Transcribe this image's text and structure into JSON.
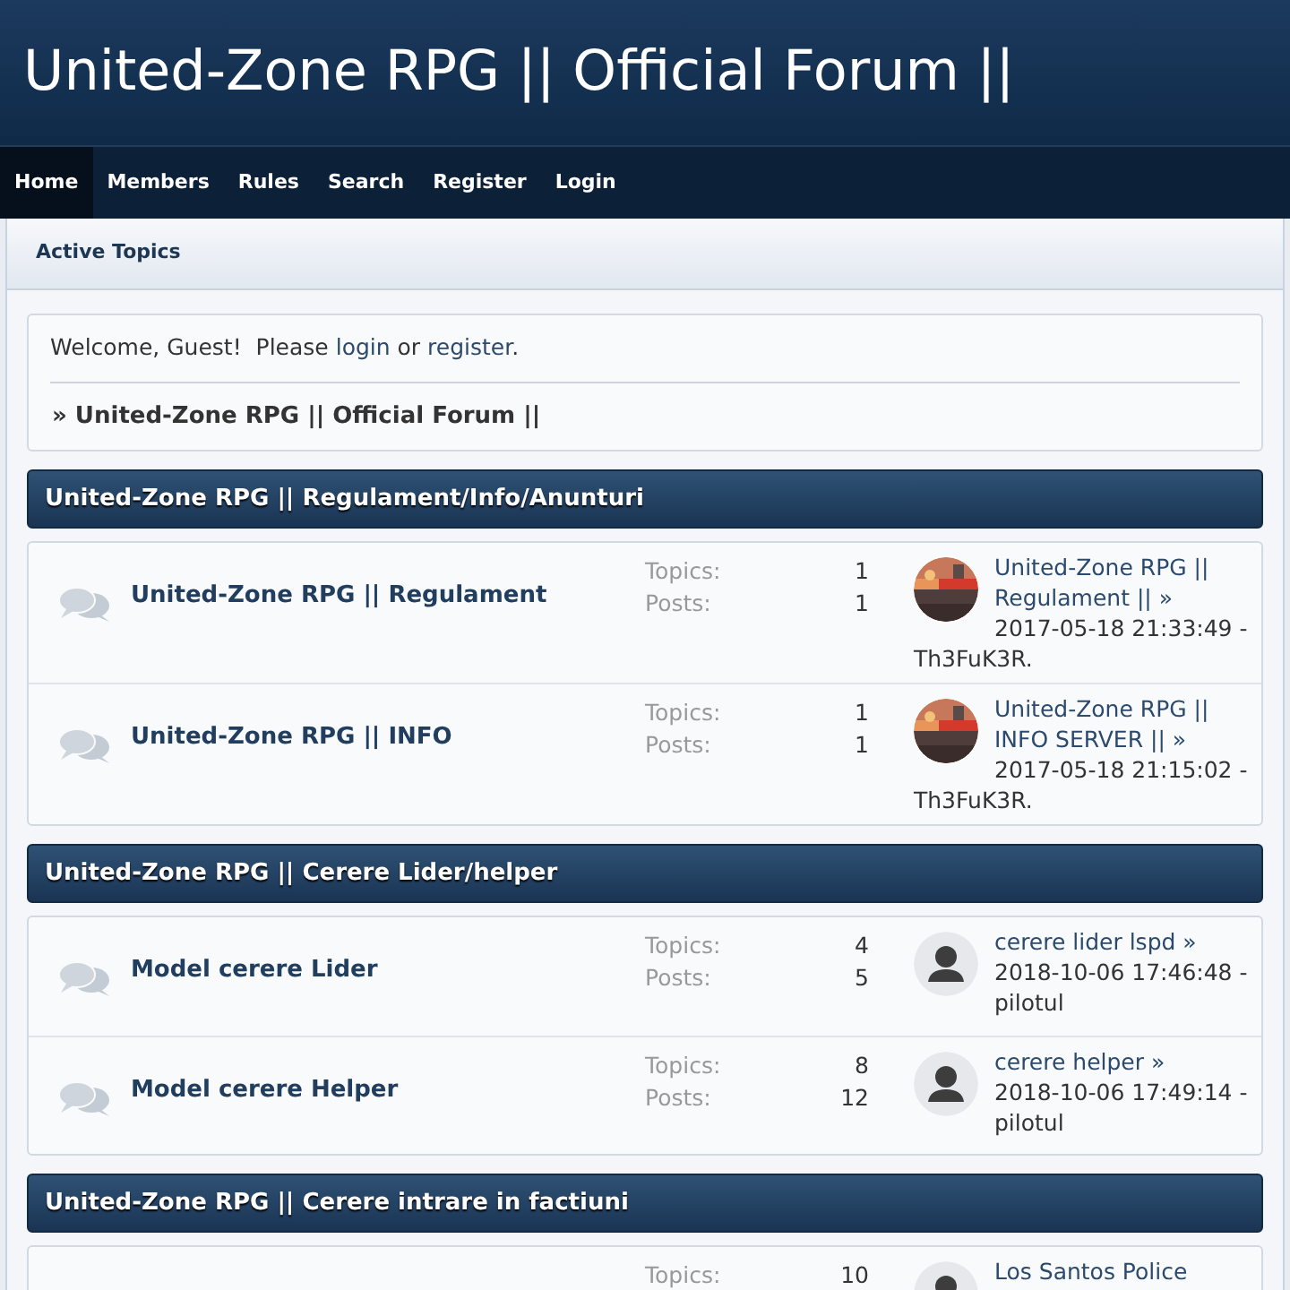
{
  "header": {
    "title": "United-Zone RPG || Official Forum ||"
  },
  "nav": [
    {
      "label": "Home",
      "selected": true
    },
    {
      "label": "Members",
      "selected": false
    },
    {
      "label": "Rules",
      "selected": false
    },
    {
      "label": "Search",
      "selected": false
    },
    {
      "label": "Register",
      "selected": false
    },
    {
      "label": "Login",
      "selected": false
    }
  ],
  "sub_nav": {
    "label": "Active Topics"
  },
  "welcome": {
    "greeting": "Welcome, Guest!  Please ",
    "login_link": "login",
    "joiner": " or ",
    "register_link": "register",
    "end": "."
  },
  "breadcrumb": "» United-Zone RPG || Official Forum ||",
  "categories": [
    {
      "title": "United-Zone RPG || Regulament/Info/Anunturi",
      "boards": [
        {
          "name": "United-Zone RPG || Regulament",
          "topics_label": "Topics:",
          "topics": "1",
          "posts_label": "Posts:",
          "posts": "1",
          "last_post": {
            "link": "United-Zone RPG || Regulament || »",
            "date": "2017-05-18 21:33:49 -",
            "author": "Th3FuK3R."
          }
        },
        {
          "name": "United-Zone RPG || INFO",
          "topics_label": "Topics:",
          "topics": "1",
          "posts_label": "Posts:",
          "posts": "1",
          "last_post": {
            "link": "United-Zone RPG || INFO SERVER || »",
            "date": "2017-05-18 21:15:02 -",
            "author": "Th3FuK3R."
          }
        }
      ]
    },
    {
      "title": "United-Zone RPG || Cerere Lider/helper",
      "boards": [
        {
          "name": "Model cerere Lider",
          "topics_label": "Topics:",
          "topics": "4",
          "posts_label": "Posts:",
          "posts": "5",
          "last_post": {
            "avatar": {
              "kind": "silhouette"
            },
            "link": "cerere lider lspd »",
            "date": "2018-10-06 17:46:48 -",
            "author": "pilotul"
          }
        },
        {
          "name": "Model cerere Helper",
          "topics_label": "Topics:",
          "topics": "8",
          "posts_label": "Posts:",
          "posts": "12",
          "last_post": {
            "avatar": {
              "kind": "silhouette"
            },
            "link": "cerere helper »",
            "date": "2018-10-06 17:49:14 -",
            "author": "pilotul"
          }
        }
      ]
    },
    {
      "title": "United-Zone RPG || Cerere intrare in factiuni",
      "boards": [
        {
          "topics_label": "Topics:",
          "topics": "10",
          "last_post": {
            "avatar": {
              "kind": "silhouette"
            },
            "link": "Los Santos Police"
          }
        }
      ]
    }
  ]
}
